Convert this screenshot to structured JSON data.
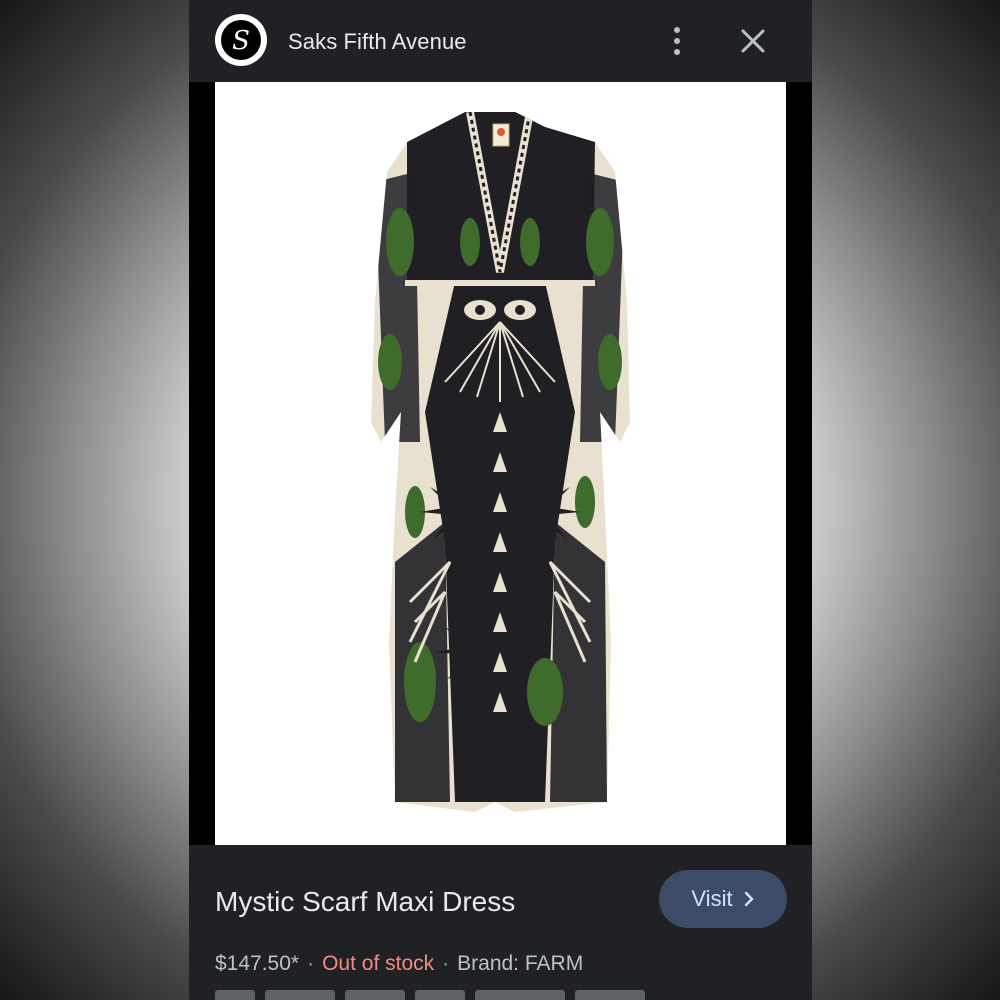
{
  "header": {
    "site_name": "Saks Fifth Avenue",
    "logo_letter": "S",
    "more_icon": "more-vert-icon",
    "close_icon": "close-icon"
  },
  "image": {
    "alt": "Mystic Scarf Maxi Dress"
  },
  "product": {
    "title": "Mystic Scarf Maxi Dress",
    "price": "$147.50*",
    "separator": "·",
    "stock_status": "Out of stock",
    "brand": "Brand: FARM"
  },
  "visit_button": {
    "label": "Visit",
    "icon": "chevron-right-icon"
  },
  "colors": {
    "background": "#202124",
    "accent_button": "#3c4c66",
    "button_text": "#d2e3fc",
    "out_of_stock": "#f28b82",
    "dress_dark": "#1f1f24",
    "dress_cream": "#e9e1cf",
    "dress_green": "#3f6b2c"
  }
}
